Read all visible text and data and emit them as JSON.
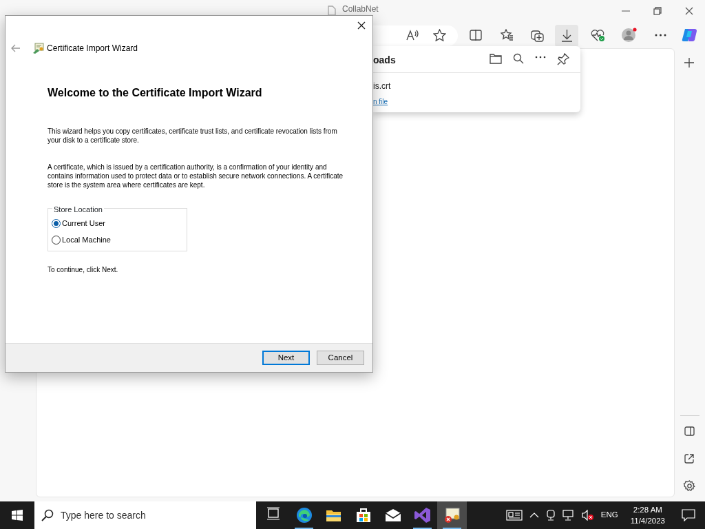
{
  "browser": {
    "tab_title": "CollabNet",
    "downloads": {
      "title": "oads",
      "file_name": "is.crt",
      "link": "n file"
    }
  },
  "dialog": {
    "title": "Certificate Import Wizard",
    "heading": "Welcome to the Certificate Import Wizard",
    "paragraphs": [
      "This wizard helps you copy certificates, certificate trust lists, and certificate revocation lists from your disk to a certificate store.",
      "A certificate, which is issued by a certification authority, is a confirmation of your identity and contains information used to protect data or to establish secure network connections. A certificate store is the system area where certificates are kept."
    ],
    "store_location": {
      "legend": "Store Location",
      "options": [
        {
          "label": "Current User",
          "selected": true
        },
        {
          "label": "Local Machine",
          "selected": false
        }
      ]
    },
    "continue_text": "To continue, click Next.",
    "buttons": [
      {
        "label": "Next",
        "default": true
      },
      {
        "label": "Cancel",
        "default": false
      }
    ]
  },
  "taskbar": {
    "search_placeholder": "Type here to search",
    "apps": [
      {
        "kind": "taskview",
        "running": false,
        "active": false
      },
      {
        "kind": "edge",
        "running": true,
        "active": false
      },
      {
        "kind": "explorer",
        "running": false,
        "active": false
      },
      {
        "kind": "store",
        "running": false,
        "active": false
      },
      {
        "kind": "mail",
        "running": false,
        "active": false
      },
      {
        "kind": "vs",
        "running": true,
        "active": false
      },
      {
        "kind": "cert",
        "running": true,
        "active": true
      }
    ],
    "language": "ENG",
    "time": "2:28 AM",
    "date": "11/4/2023"
  }
}
